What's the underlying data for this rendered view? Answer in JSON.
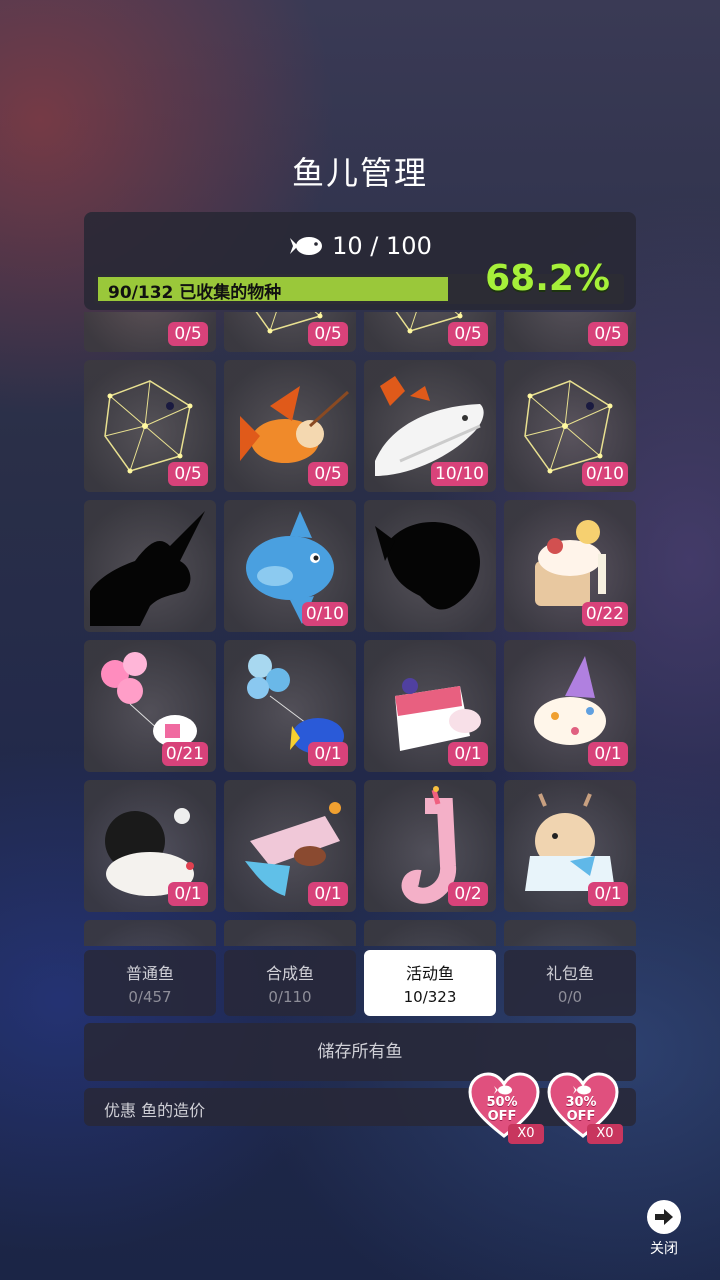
{
  "title": "鱼儿管理",
  "summary": {
    "fish_count": "10 / 100",
    "progress_text": "90/132 已收集的物种",
    "progress_fraction": 0.682,
    "percent": "68.2%",
    "accent_color": "#a6f03a"
  },
  "grid": {
    "cells": [
      {
        "name": "maple-fish",
        "count": "0/5",
        "art": "leaf"
      },
      {
        "name": "constellation-a",
        "count": "0/5",
        "art": "constellation"
      },
      {
        "name": "constellation-b",
        "count": "0/5",
        "art": "constellation"
      },
      {
        "name": "maple-fish-2",
        "count": "0/5",
        "art": "leaf"
      },
      {
        "name": "constellation-fish",
        "count": "0/5",
        "art": "constellation"
      },
      {
        "name": "goldfish-with-stick",
        "count": "0/5",
        "art": "goldfish"
      },
      {
        "name": "white-whale",
        "count": "10/10",
        "art": "whale"
      },
      {
        "name": "constellation-whale",
        "count": "0/10",
        "art": "constellation"
      },
      {
        "name": "narwhal-silhouette",
        "count": "",
        "art": "silhouette-narwhal"
      },
      {
        "name": "sunfish",
        "count": "0/10",
        "art": "sunfish"
      },
      {
        "name": "fish-silhouette",
        "count": "",
        "art": "silhouette-fish"
      },
      {
        "name": "dessert-fish",
        "count": "0/22",
        "art": "dessert"
      },
      {
        "name": "balloon-clownfish",
        "count": "0/21",
        "art": "balloon-clown"
      },
      {
        "name": "balloon-bluetang",
        "count": "0/1",
        "art": "balloon-blue"
      },
      {
        "name": "cake-fish",
        "count": "0/1",
        "art": "cake"
      },
      {
        "name": "party-fish",
        "count": "0/1",
        "art": "party"
      },
      {
        "name": "poodle-fish",
        "count": "0/1",
        "art": "poodle"
      },
      {
        "name": "squid-cake",
        "count": "0/1",
        "art": "squid"
      },
      {
        "name": "candle-seahorse",
        "count": "0/2",
        "art": "seahorse"
      },
      {
        "name": "cow-jellyfish",
        "count": "0/1",
        "art": "cow"
      }
    ]
  },
  "tabs": [
    {
      "label": "普通鱼",
      "sub": "0/457"
    },
    {
      "label": "合成鱼",
      "sub": "0/110"
    },
    {
      "label": "活动鱼",
      "sub": "10/323",
      "active": true
    },
    {
      "label": "礼包鱼",
      "sub": "0/0"
    }
  ],
  "store_button": "储存所有鱼",
  "discount": {
    "label": "优惠 鱼的造价",
    "coupons": [
      {
        "pct": "50%",
        "off": "OFF",
        "count": "X0"
      },
      {
        "pct": "30%",
        "off": "OFF",
        "count": "X0"
      }
    ]
  },
  "close": {
    "label": "关闭"
  }
}
